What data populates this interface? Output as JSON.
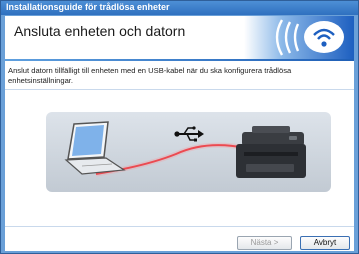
{
  "window": {
    "title": "Installationsguide för trådlösa enheter"
  },
  "header": {
    "heading": "Ansluta enheten och datorn"
  },
  "description": "Anslut datorn tillfälligt till enheten med en USB-kabel när du ska konfigurera trådlösa enhetsinställningar.",
  "illustration": {
    "laptop": "laptop-icon",
    "usb": "usb-icon",
    "printer": "printer-icon",
    "cable_color": "#e8232a"
  },
  "logo": {
    "icon": "wireless-logo-icon",
    "accent": "#1d5fc0"
  },
  "buttons": {
    "next_label": "Nästa >",
    "next_enabled": false,
    "cancel_label": "Avbryt"
  },
  "colors": {
    "titlebar": "#3d82cf",
    "frame": "#6aa0d8"
  }
}
